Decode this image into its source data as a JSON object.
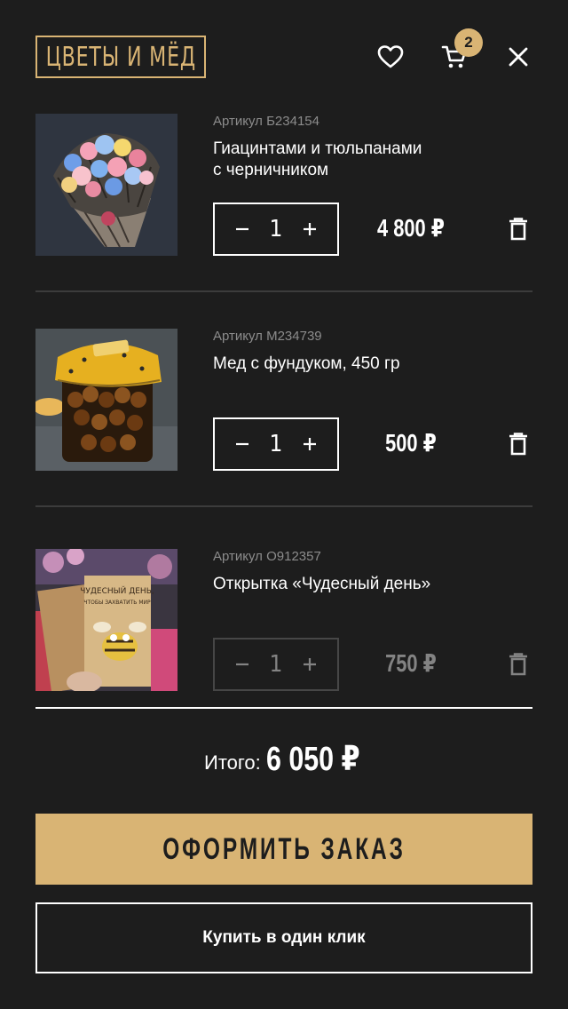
{
  "header": {
    "logo_text": "ЦВЕТЫ И МЁД",
    "favorites_icon": "heart-icon",
    "cart_icon": "cart-icon",
    "cart_count": "2",
    "close_icon": "close-icon"
  },
  "colors": {
    "background": "#1d1d1d",
    "accent": "#d9b474",
    "text": "#ffffff",
    "muted": "#8c8c8c",
    "divider": "#3c3c3c"
  },
  "items": [
    {
      "sku": "Артикул Б234154",
      "name_line1": "Гиацинтами и тюльпанами",
      "name_line2": "с черничником",
      "quantity": "1",
      "price": "4 800 ₽",
      "available": true
    },
    {
      "sku": "Артикул М234739",
      "name_line1": "Мед с фундуком, 450 гр",
      "name_line2": "",
      "quantity": "1",
      "price": "500 ₽",
      "available": true
    },
    {
      "sku": "Артикул О912357",
      "name_line1": "Открытка «Чудесный день»",
      "name_line2": "",
      "quantity": "1",
      "price": "750 ₽",
      "available": false,
      "card_text_line1": "ЧУДЕСНЫЙ ДЕНЬ,",
      "card_text_line2": "ЧТОБЫ ЗАХВАТИТЬ МИР"
    }
  ],
  "summary": {
    "total_label": "Итого:",
    "total_value": "6 050 ₽"
  },
  "actions": {
    "order_label": "ОФОРМИТЬ ЗАКАЗ",
    "one_click_label": "Купить в один клик"
  }
}
